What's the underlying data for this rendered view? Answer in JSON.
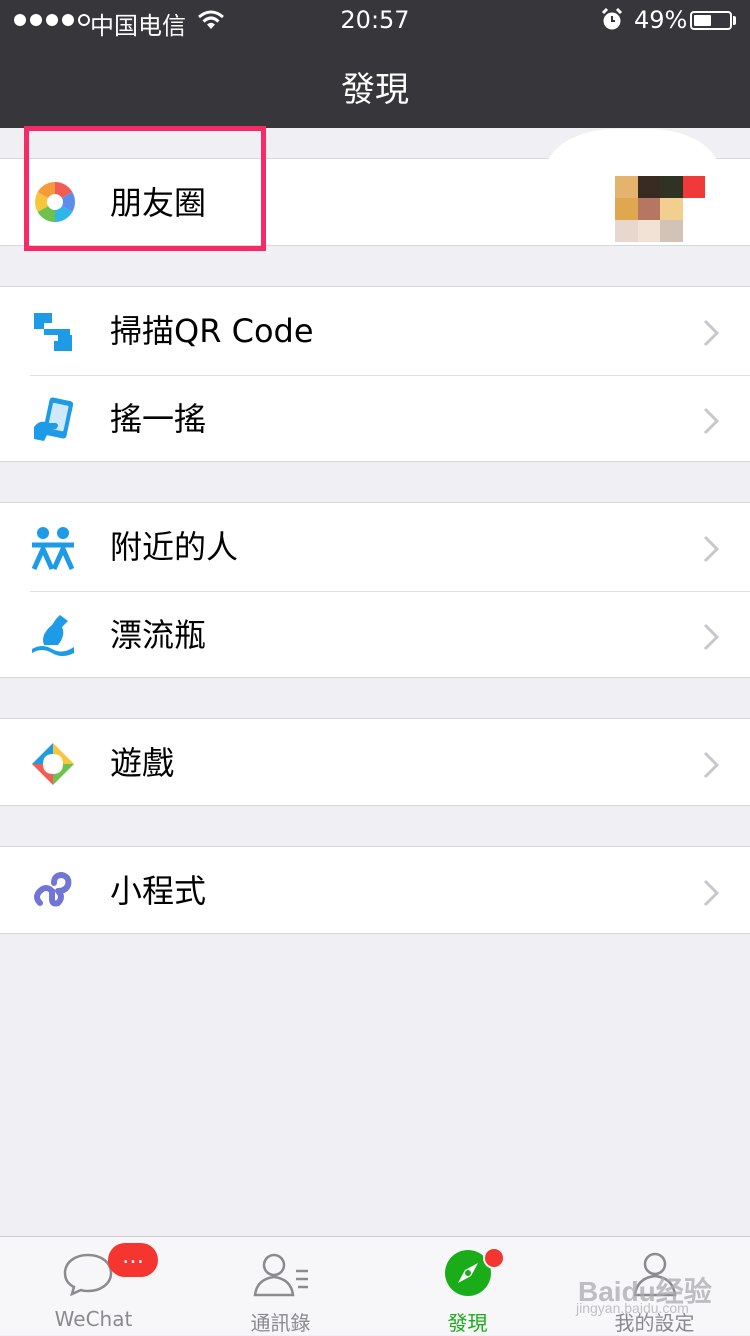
{
  "status_bar": {
    "carrier": "中国电信",
    "time": "20:57",
    "battery_percent_text": "49%",
    "battery_level": 0.49
  },
  "nav": {
    "title": "發現"
  },
  "sections": [
    {
      "rows": [
        {
          "label": "朋友圈",
          "icon": "moments-icon",
          "chevron": false
        }
      ]
    },
    {
      "rows": [
        {
          "label": "掃描QR Code",
          "icon": "scan-qr-icon",
          "chevron": true
        },
        {
          "label": "搖一搖",
          "icon": "shake-icon",
          "chevron": true
        }
      ]
    },
    {
      "rows": [
        {
          "label": "附近的人",
          "icon": "people-nearby-icon",
          "chevron": true
        },
        {
          "label": "漂流瓶",
          "icon": "drift-bottle-icon",
          "chevron": true
        }
      ]
    },
    {
      "rows": [
        {
          "label": "遊戲",
          "icon": "games-icon",
          "chevron": true
        }
      ]
    },
    {
      "rows": [
        {
          "label": "小程式",
          "icon": "mini-programs-icon",
          "chevron": true
        }
      ]
    }
  ],
  "tabbar": {
    "tabs": [
      {
        "label": "WeChat",
        "icon": "chat-bubble-icon",
        "badge": "…"
      },
      {
        "label": "通訊錄",
        "icon": "contacts-icon"
      },
      {
        "label": "發現",
        "icon": "compass-icon",
        "active": true
      },
      {
        "label": "我的設定",
        "icon": "profile-icon"
      }
    ]
  },
  "watermark": {
    "text": "Baidu经验",
    "sub": "jingyan.baidu.com"
  },
  "colors": {
    "nav_bg": "#37363b",
    "page_bg": "#efeff4",
    "active_green": "#1aad19",
    "badge_red": "#f43530",
    "highlight": "#f52a67"
  }
}
